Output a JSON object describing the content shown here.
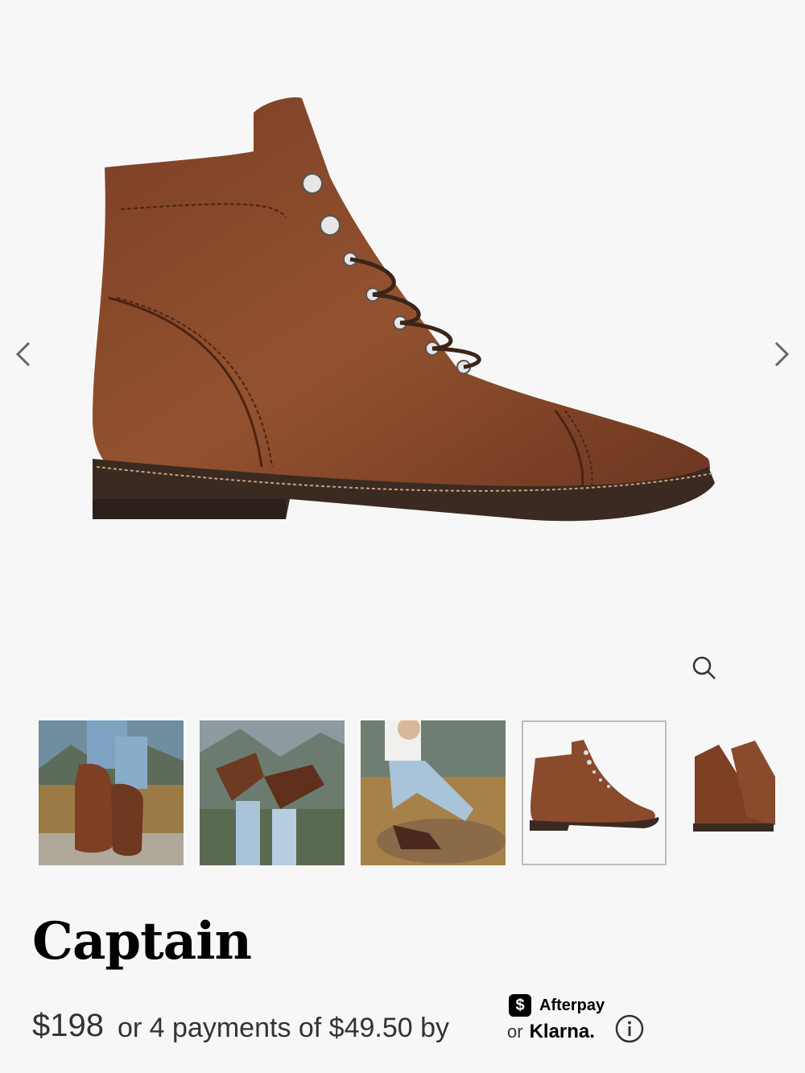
{
  "product": {
    "title": "Captain",
    "price": "$198",
    "installments": "or 4 payments of $49.50 by",
    "afterpay_label": "Afterpay",
    "afterpay_badge": "$",
    "or_label": "or",
    "klarna_label": "Klarna."
  },
  "gallery": {
    "prev_icon": "chevron-left-icon",
    "next_icon": "chevron-right-icon",
    "zoom_icon": "magnifier-icon",
    "thumbnails": [
      {
        "name": "boots-on-rock-photo"
      },
      {
        "name": "boots-in-air-photo"
      },
      {
        "name": "woman-sitting-photo"
      },
      {
        "name": "boot-side-view",
        "selected": true
      },
      {
        "name": "boot-pair-angle"
      }
    ]
  },
  "colors": {
    "leather": "#8a4a2c",
    "leather_dark": "#5e2f1a",
    "sole": "#3a2a22",
    "background": "#f7f7f7"
  }
}
